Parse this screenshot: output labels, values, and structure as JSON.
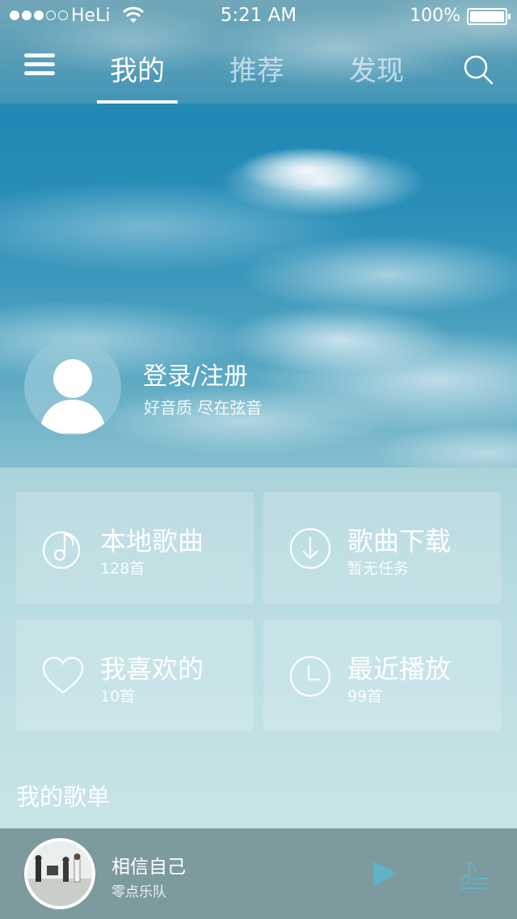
{
  "status_bar": {
    "carrier": "HeLi",
    "time": "5:21 AM",
    "battery": "100%"
  },
  "nav": {
    "tabs": [
      {
        "label": "我的",
        "active": true
      },
      {
        "label": "推荐",
        "active": false
      },
      {
        "label": "发现",
        "active": false
      }
    ]
  },
  "profile": {
    "login_label": "登录/注册",
    "subtitle": "好音质 尽在弦音"
  },
  "grid": [
    {
      "title": "本地歌曲",
      "sub": "128首",
      "icon": "music-note-icon"
    },
    {
      "title": "歌曲下载",
      "sub": "暂无任务",
      "icon": "download-icon"
    },
    {
      "title": "我喜欢的",
      "sub": "10首",
      "icon": "heart-icon"
    },
    {
      "title": "最近播放",
      "sub": "99首",
      "icon": "clock-icon"
    }
  ],
  "section": {
    "my_playlists": "我的歌单"
  },
  "player": {
    "song_title": "相信自己",
    "artist": "零点乐队"
  },
  "colors": {
    "play_button": "#5fb3c4",
    "playlist_icon": "#5fb3c4"
  }
}
